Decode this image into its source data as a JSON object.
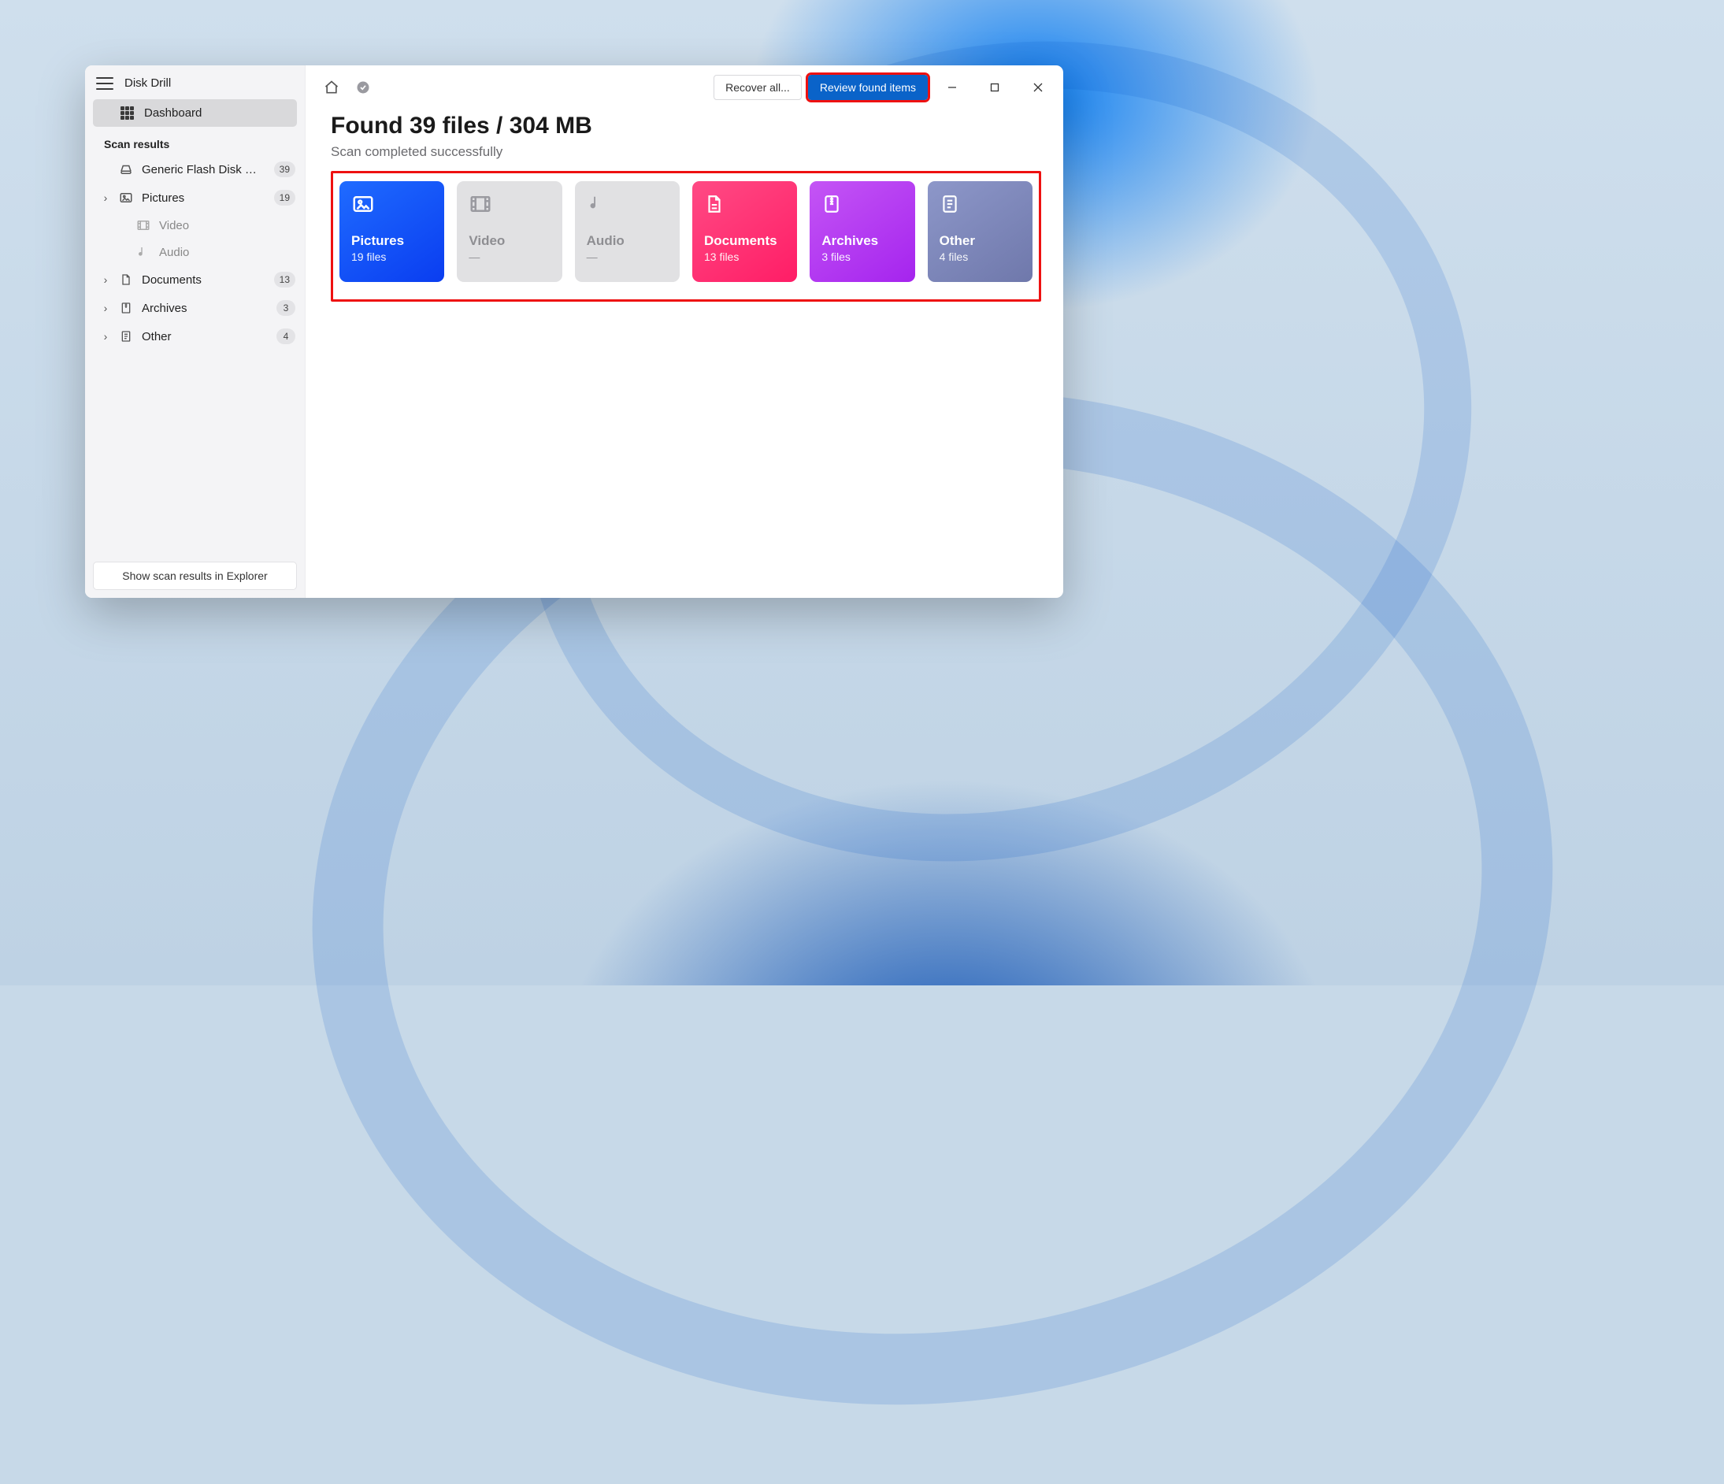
{
  "app": {
    "title": "Disk Drill"
  },
  "sidebar": {
    "dashboard_label": "Dashboard",
    "section_label": "Scan results",
    "items": [
      {
        "label": "Generic Flash Disk USB D...",
        "badge": "39"
      },
      {
        "label": "Pictures",
        "badge": "19"
      },
      {
        "label": "Video"
      },
      {
        "label": "Audio"
      },
      {
        "label": "Documents",
        "badge": "13"
      },
      {
        "label": "Archives",
        "badge": "3"
      },
      {
        "label": "Other",
        "badge": "4"
      }
    ],
    "footer_button": "Show scan results in Explorer"
  },
  "toolbar": {
    "recover_label": "Recover all...",
    "review_label": "Review found items"
  },
  "summary": {
    "headline": "Found 39 files / 304 MB",
    "subhead": "Scan completed successfully"
  },
  "cards": [
    {
      "title": "Pictures",
      "sub": "19 files"
    },
    {
      "title": "Video",
      "sub": "—"
    },
    {
      "title": "Audio",
      "sub": "—"
    },
    {
      "title": "Documents",
      "sub": "13 files"
    },
    {
      "title": "Archives",
      "sub": "3 files"
    },
    {
      "title": "Other",
      "sub": "4 files"
    }
  ]
}
